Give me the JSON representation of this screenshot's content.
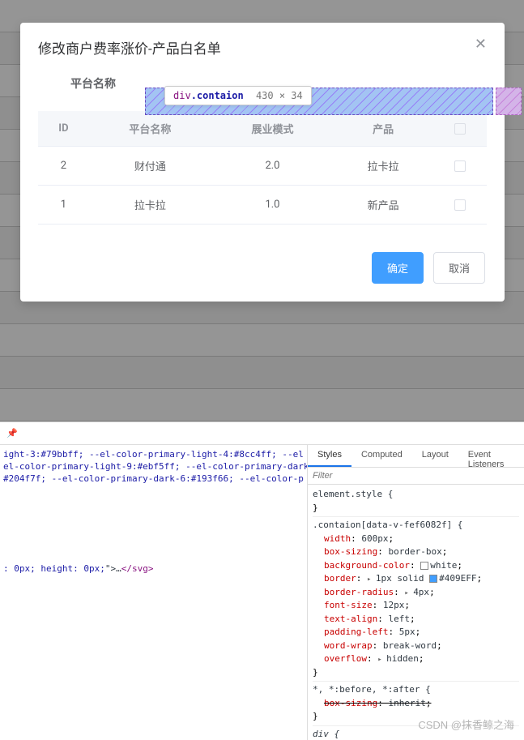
{
  "modal": {
    "title": "修改商户费率涨价-产品白名单",
    "close_label": "✕",
    "form": {
      "platform_label": "平台名称"
    },
    "tooltip": {
      "tag": "div",
      "cls": ".contaion",
      "dims": "430 × 34"
    },
    "table": {
      "headers": {
        "id": "ID",
        "platform": "平台名称",
        "mode": "展业模式",
        "product": "产品"
      },
      "rows": [
        {
          "id": "2",
          "platform": "财付通",
          "mode": "2.0",
          "product": "拉卡拉"
        },
        {
          "id": "1",
          "platform": "拉卡拉",
          "mode": "1.0",
          "product": "新产品"
        }
      ]
    },
    "footer": {
      "confirm": "确定",
      "cancel": "取消"
    }
  },
  "devtools": {
    "tabs": {
      "styles": "Styles",
      "computed": "Computed",
      "layout": "Layout",
      "listeners": "Event Listeners"
    },
    "filter_placeholder": "Filter",
    "elements_lines": [
      "ight-3:#79bbff; --el-color-primary-light-4:#8cc4ff; --el",
      "el-color-primary-light-9:#ebf5ff; --el-color-primary-dark",
      " #204f7f; --el-color-primary-dark-6:#193f66; --el-color-p",
      "",
      ": 0px; height: 0px;\">…</svg>"
    ],
    "styles": {
      "element_style": "element.style {",
      "brace_close": "}",
      "selector": ".contaion[data-v-fef6082f] {",
      "width": {
        "p": "width",
        "v": "600px"
      },
      "box_sizing": {
        "p": "box-sizing",
        "v": "border-box"
      },
      "bg": {
        "p": "background-color",
        "v": "white",
        "swatch": "#ffffff"
      },
      "border": {
        "p": "border",
        "v": "1px solid ",
        "swatch": "#409EFF",
        "v2": "#409EFF",
        "tri": true
      },
      "radius": {
        "p": "border-radius",
        "v": "4px",
        "tri": true
      },
      "font_size": {
        "p": "font-size",
        "v": "12px"
      },
      "text_align": {
        "p": "text-align",
        "v": "left"
      },
      "padding_left": {
        "p": "padding-left",
        "v": "5px"
      },
      "word_wrap": {
        "p": "word-wrap",
        "v": "break-word"
      },
      "overflow": {
        "p": "overflow",
        "v": "hidden",
        "tri": true
      },
      "universal_sel": "*, *:before, *:after {",
      "inherit": {
        "p": "box-sizing",
        "v": "inherit"
      },
      "div_sel": "div {"
    }
  },
  "watermark": "CSDN @抹香鲸之海"
}
